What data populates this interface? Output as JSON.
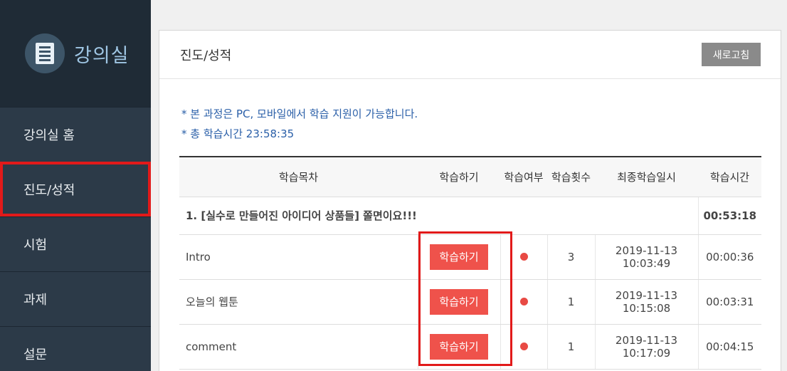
{
  "sidebar": {
    "brand_title": "강의실",
    "items": [
      {
        "label": "강의실 홈"
      },
      {
        "label": "진도/성적"
      },
      {
        "label": "시험"
      },
      {
        "label": "과제"
      },
      {
        "label": "설문"
      }
    ]
  },
  "main": {
    "title": "진도/성적",
    "refresh_label": "새로고침",
    "notes": [
      "* 본 과정은 PC, 모바일에서 학습 지원이 가능합니다.",
      "* 총 학습시간 23:58:35"
    ],
    "columns": [
      "학습목차",
      "학습하기",
      "학습여부",
      "학습횟수",
      "최종학습일시",
      "학습시간"
    ],
    "chapter": {
      "title": "1. [실수로 만들어진 아이디어 상품들] 쫄면이요!!!",
      "time": "00:53:18"
    },
    "lessons": [
      {
        "title": "Intro",
        "button": "학습하기",
        "count": "3",
        "last": "2019-11-13 10:03:49",
        "time": "00:00:36"
      },
      {
        "title": "오늘의 웹툰",
        "button": "학습하기",
        "count": "1",
        "last": "2019-11-13 10:15:08",
        "time": "00:03:31"
      },
      {
        "title": "comment",
        "button": "학습하기",
        "count": "1",
        "last": "2019-11-13 10:17:09",
        "time": "00:04:15"
      }
    ]
  },
  "colors": {
    "sidebar": "#2c3a48",
    "accent_red": "#ef524b",
    "note_blue": "#2a5fa8"
  },
  "icons": {
    "brand": "document-list-icon"
  }
}
